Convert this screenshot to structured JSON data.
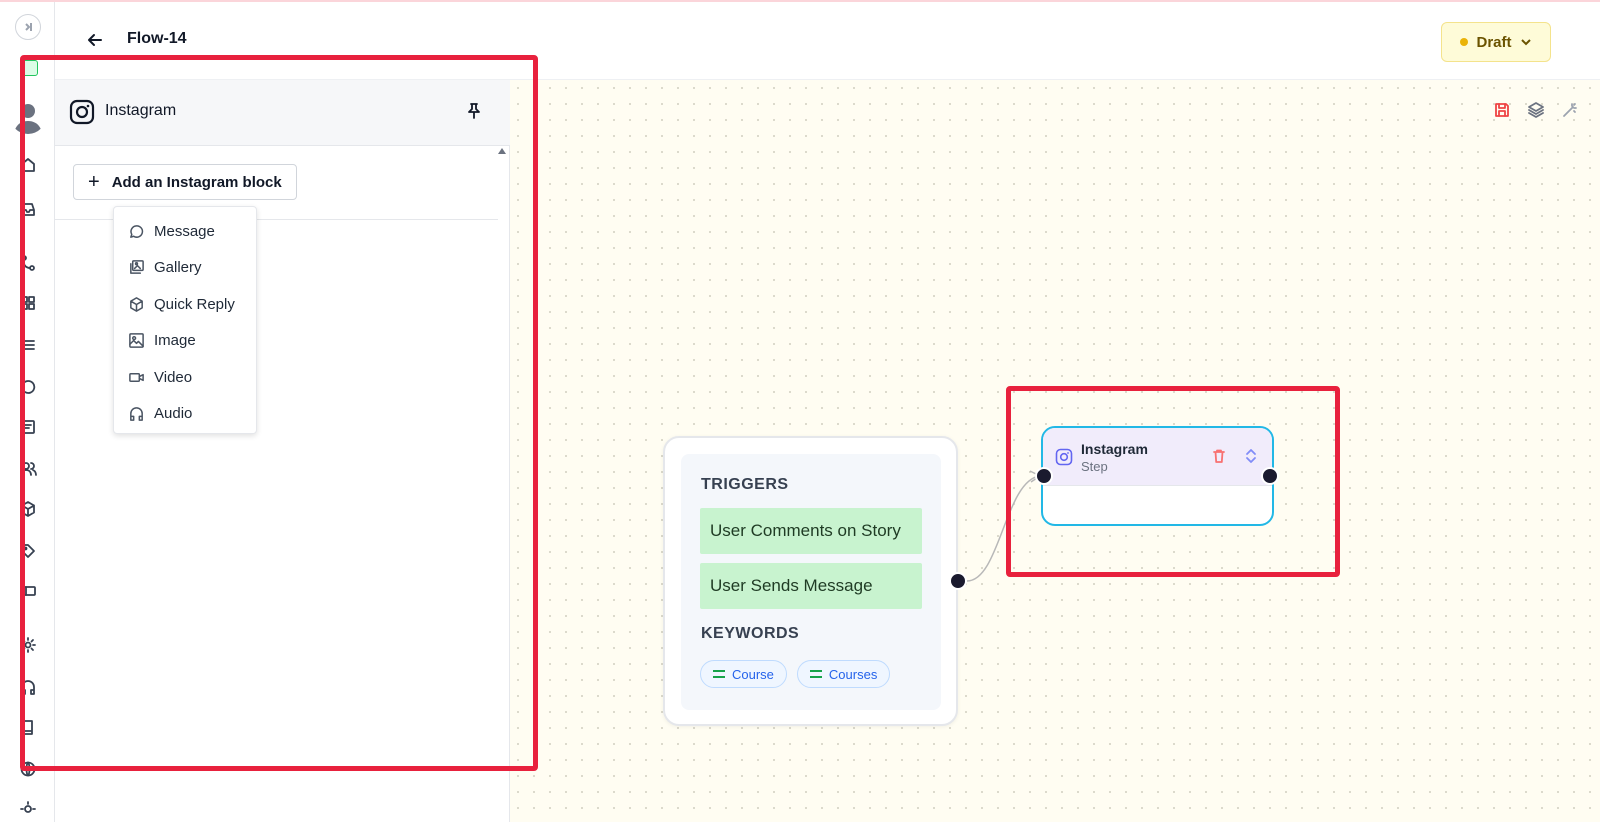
{
  "header": {
    "flow_title": "Flow-14",
    "status_label": "Draft"
  },
  "panel": {
    "title": "Instagram",
    "add_block_label": "Add an Instagram block",
    "block_menu": [
      {
        "label": "Message",
        "icon": "message-icon"
      },
      {
        "label": "Gallery",
        "icon": "gallery-icon"
      },
      {
        "label": "Quick Reply",
        "icon": "cube-icon"
      },
      {
        "label": "Image",
        "icon": "image-icon"
      },
      {
        "label": "Video",
        "icon": "video-icon"
      },
      {
        "label": "Audio",
        "icon": "headphones-icon"
      }
    ]
  },
  "trigger_node": {
    "triggers_title": "TRIGGERS",
    "triggers": [
      "User Comments on Story",
      "User Sends Message"
    ],
    "keywords_title": "KEYWORDS",
    "keywords": [
      "Course",
      "Courses"
    ]
  },
  "step_node": {
    "title": "Instagram",
    "subtitle": "Step"
  },
  "colors": {
    "highlight": "#e8213d",
    "trigger_item_bg": "#c8f3cf",
    "step_border": "#22b8e6",
    "draft_bg": "#fefbd8",
    "draft_dot": "#eab308"
  }
}
